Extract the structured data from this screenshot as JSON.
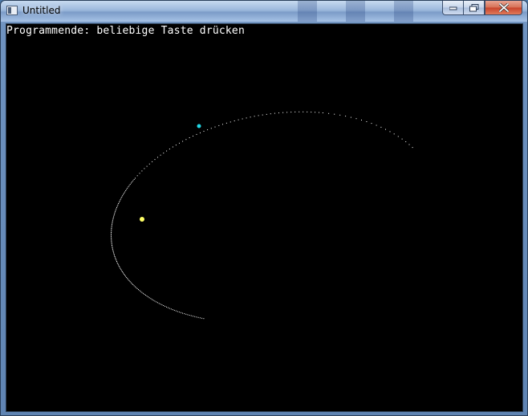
{
  "window": {
    "title": "Untitled",
    "icon": "console-window-icon"
  },
  "controls": {
    "minimize": "minimize-icon",
    "maximize": "maximize-icon",
    "close": "close-icon"
  },
  "console": {
    "prompt_text": "Programmende: beliebige Taste drücken"
  },
  "colors": {
    "background": "#000000",
    "text": "#ffffff",
    "orbit_trail": "#ffffff",
    "planet": "#22d8e6",
    "sun": "#ffff66"
  }
}
